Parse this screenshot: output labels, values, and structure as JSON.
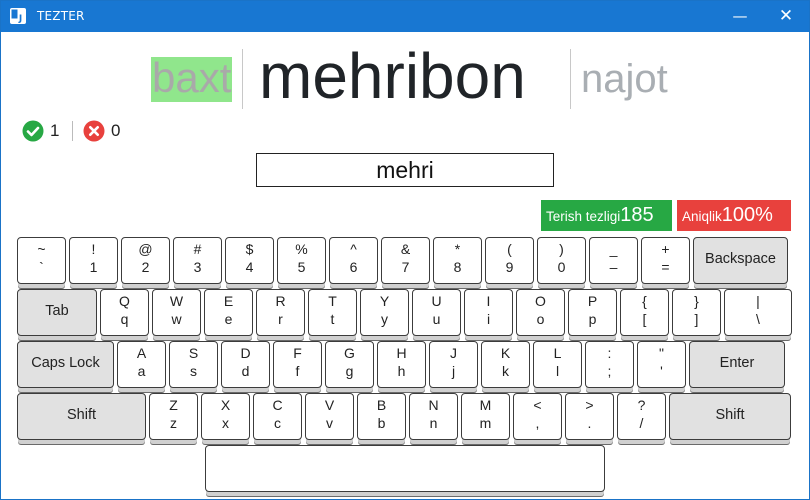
{
  "window": {
    "title": "TEZTER",
    "minimize_glyph": "—",
    "close_glyph": "✕"
  },
  "words": {
    "previous": "baxt",
    "current": "mehribon",
    "next": "najot"
  },
  "stats": {
    "correct": "1",
    "wrong": "0"
  },
  "input": {
    "value": "mehri"
  },
  "speed": {
    "label": "Terish tezligi",
    "value": "185"
  },
  "accuracy": {
    "label": "Aniqlik",
    "value": "100%"
  },
  "colors": {
    "titlebar": "#1877d2",
    "correct_green": "#27a844",
    "wrong_red": "#e8413d",
    "prev_highlight": "#90e68c"
  },
  "keyboard": {
    "rows": [
      [
        [
          "~",
          "`"
        ],
        [
          "!",
          "1"
        ],
        [
          "@",
          "2"
        ],
        [
          "#",
          "3"
        ],
        [
          "$",
          "4"
        ],
        [
          "%",
          "5"
        ],
        [
          "^",
          "6"
        ],
        [
          "&",
          "7"
        ],
        [
          "*",
          "8"
        ],
        [
          "(",
          "9"
        ],
        [
          ")",
          "0"
        ],
        [
          "_",
          "–"
        ],
        [
          "+",
          "="
        ],
        [
          "Backspace"
        ]
      ],
      [
        [
          "Tab"
        ],
        [
          "Q",
          "q"
        ],
        [
          "W",
          "w"
        ],
        [
          "E",
          "e"
        ],
        [
          "R",
          "r"
        ],
        [
          "T",
          "t"
        ],
        [
          "Y",
          "y"
        ],
        [
          "U",
          "u"
        ],
        [
          "I",
          "i"
        ],
        [
          "O",
          "o"
        ],
        [
          "P",
          "p"
        ],
        [
          "{",
          "["
        ],
        [
          "}",
          "]"
        ],
        [
          "|",
          "\\"
        ]
      ],
      [
        [
          "Caps Lock"
        ],
        [
          "A",
          "a"
        ],
        [
          "S",
          "s"
        ],
        [
          "D",
          "d"
        ],
        [
          "F",
          "f"
        ],
        [
          "G",
          "g"
        ],
        [
          "H",
          "h"
        ],
        [
          "J",
          "j"
        ],
        [
          "K",
          "k"
        ],
        [
          "L",
          "l"
        ],
        [
          ":",
          ";"
        ],
        [
          "\"",
          "'"
        ],
        [
          "Enter"
        ]
      ],
      [
        [
          "Shift"
        ],
        [
          "Z",
          "z"
        ],
        [
          "X",
          "x"
        ],
        [
          "C",
          "c"
        ],
        [
          "V",
          "v"
        ],
        [
          "B",
          "b"
        ],
        [
          "N",
          "n"
        ],
        [
          "M",
          "m"
        ],
        [
          "<",
          ","
        ],
        [
          ">",
          "."
        ],
        [
          "?",
          "/"
        ],
        [
          "Shift"
        ]
      ],
      [
        [
          ""
        ]
      ]
    ]
  }
}
